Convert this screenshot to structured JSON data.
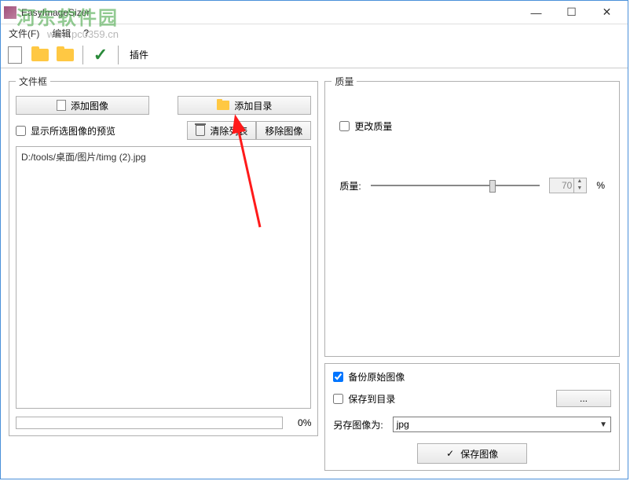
{
  "window": {
    "title": "EasyImageSizer"
  },
  "menu": {
    "file": "文件(F)",
    "edit": "编辑",
    "help": "?"
  },
  "toolbar": {
    "plugin": "插件"
  },
  "left_panel": {
    "legend": "文件框",
    "add_image": "添加图像",
    "add_folder": "添加目录",
    "show_preview_label": "显示所选图像的预览",
    "clear_list": "清除列表",
    "remove_image": "移除图像",
    "files": [
      "D:/tools/桌面/图片/timg (2).jpg"
    ],
    "progress_text": "0%"
  },
  "right_panel": {
    "quality_legend": "质量",
    "change_quality_label": "更改质量",
    "quality_label": "质量:",
    "quality_value": "70",
    "percent": "%",
    "backup_original_label": "备份原始图像",
    "save_to_folder_label": "保存到目录",
    "path_button": "...",
    "save_as_label": "另存图像为:",
    "format_selected": "jpg",
    "save_button": "保存图像"
  },
  "watermark": {
    "text": "河东软件园",
    "url": "www.pc0359.cn"
  }
}
